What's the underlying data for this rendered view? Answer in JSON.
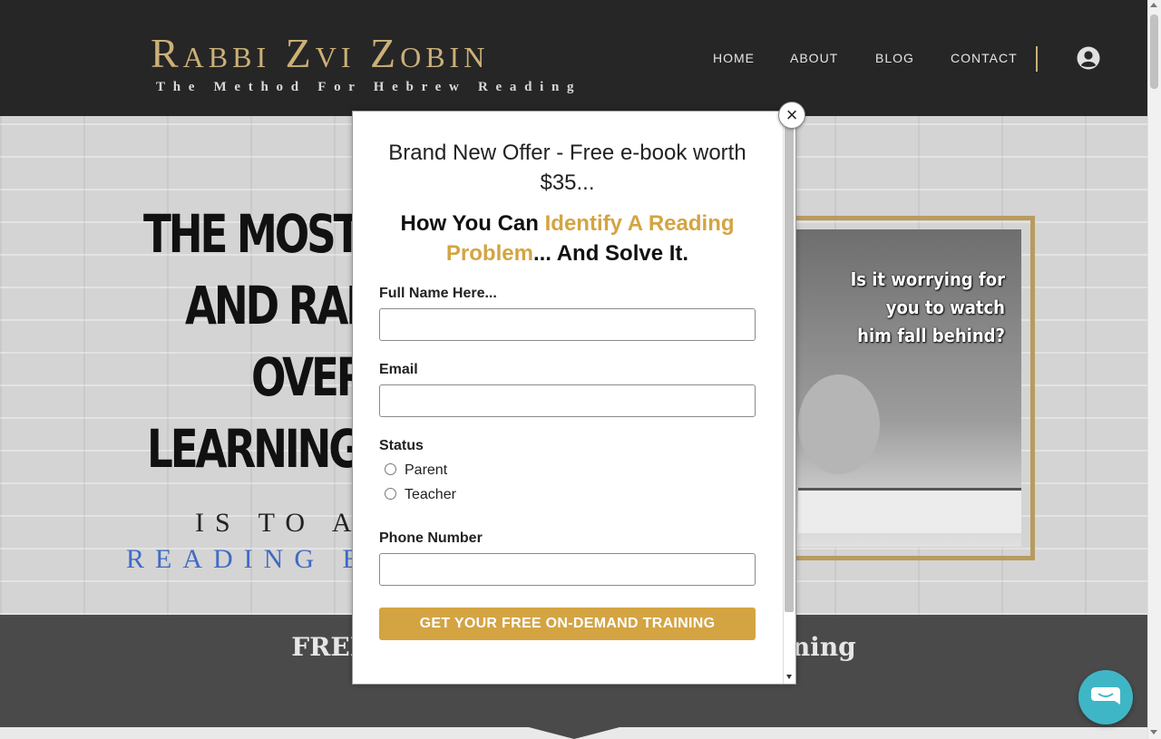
{
  "header": {
    "logo_title": "Rabbi Zvi Zobin",
    "logo_subtitle": "The Method For Hebrew Reading",
    "nav": [
      "HOME",
      "ABOUT",
      "BLOG",
      "CONTACT"
    ]
  },
  "hero": {
    "lines": [
      "THE MOST DI",
      "AND RAPI",
      "OVERC",
      "LEARNING D"
    ],
    "sub1": "IS TO AC",
    "sub2": "READING EF",
    "photo_caption": "Is it worrying for you to watch him fall behind?"
  },
  "band": {
    "text": "FREE Webinar Succeed In His Learning"
  },
  "modal": {
    "title": "Brand New Offer - Free e-book worth $35...",
    "headline_pre": "How You Can ",
    "headline_highlight": "Identify A Reading Problem",
    "headline_post": "... And Solve It.",
    "name_label": "Full Name Here...",
    "email_label": "Email",
    "status_label": "Status",
    "status_options": [
      "Parent",
      "Teacher"
    ],
    "phone_label": "Phone Number",
    "cta": "GET YOUR FREE ON-DEMAND TRAINING",
    "close": "×"
  },
  "colors": {
    "gold": "#d4a442",
    "header_bg": "#262626",
    "chat": "#3fb6c6"
  },
  "icons": {
    "user": "user-circle-icon",
    "chat": "chat-bubble-icon",
    "close": "close-icon"
  }
}
